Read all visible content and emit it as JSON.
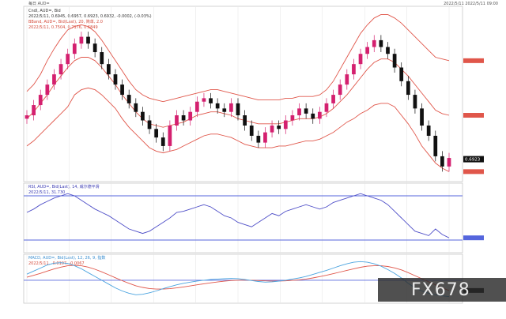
{
  "header": {
    "left": "每日  AUD=",
    "right": "2022/5/11  2022/5/11 09:00"
  },
  "panels": {
    "price": {
      "legend": [
        {
          "text": "Cndl, AUD=, Bid",
          "color": "#333333"
        },
        {
          "text": "2022/5/11, 0.6945, 0.6957, 0.6923, 0.6932, -0.0002, (-0.03%)",
          "color": "#333333"
        },
        {
          "text": "BBand, AUD=, Bid(Last), 20, 简单, 2.0",
          "color": "#d44a3a"
        },
        {
          "text": "2022/5/11, 0.7504, 0.7176, 0.6849",
          "color": "#d44a3a"
        }
      ]
    },
    "rsi": {
      "legend": [
        {
          "text": "RSI, AUD=, Bid(Last), 14, 威尔德平滑",
          "color": "#3b3bb3"
        },
        {
          "text": "2022/5/11, 31.730",
          "color": "#3b3bb3"
        }
      ]
    },
    "macd": {
      "legend": [
        {
          "text": "MACD, AUD=, Bid(Last), 12, 26, 9, 指数",
          "color": "#3b8fd0"
        },
        {
          "text": "2022/5/11, -0.0107, -0.0067",
          "color": "#d44a3a"
        }
      ]
    }
  },
  "watermark": "FX678",
  "colors": {
    "up": "#d4206f",
    "down": "#111111",
    "bands": "#e0564a",
    "rsi": "#4f4fc8",
    "macd": "#4aa3df",
    "signal": "#e0564a",
    "ref": "#5566dd",
    "grid": "#e3e3e3"
  },
  "chart_data": [
    {
      "type": "candlestick",
      "series": [
        {
          "name": "Cndl, AUD=, Bid",
          "close": [
            0.718,
            0.724,
            0.73,
            0.736,
            0.742,
            0.748,
            0.754,
            0.76,
            0.764,
            0.76,
            0.755,
            0.748,
            0.742,
            0.736,
            0.73,
            0.725,
            0.72,
            0.715,
            0.71,
            0.705,
            0.7,
            0.712,
            0.718,
            0.715,
            0.72,
            0.726,
            0.728,
            0.725,
            0.722,
            0.72,
            0.725,
            0.718,
            0.712,
            0.706,
            0.702,
            0.708,
            0.712,
            0.71,
            0.715,
            0.718,
            0.722,
            0.719,
            0.716,
            0.72,
            0.725,
            0.73,
            0.736,
            0.742,
            0.748,
            0.754,
            0.758,
            0.762,
            0.758,
            0.754,
            0.746,
            0.738,
            0.73,
            0.722,
            0.712,
            0.706,
            0.694,
            0.688,
            0.693
          ]
        },
        {
          "name": "BBand upper",
          "values": [
            0.732,
            0.736,
            0.742,
            0.75,
            0.757,
            0.763,
            0.768,
            0.77,
            0.771,
            0.77,
            0.767,
            0.762,
            0.756,
            0.75,
            0.744,
            0.738,
            0.733,
            0.73,
            0.728,
            0.727,
            0.726,
            0.727,
            0.728,
            0.729,
            0.73,
            0.731,
            0.732,
            0.733,
            0.733,
            0.732,
            0.731,
            0.73,
            0.729,
            0.728,
            0.727,
            0.727,
            0.727,
            0.727,
            0.728,
            0.728,
            0.729,
            0.729,
            0.729,
            0.73,
            0.733,
            0.738,
            0.745,
            0.752,
            0.759,
            0.766,
            0.771,
            0.775,
            0.777,
            0.777,
            0.775,
            0.772,
            0.768,
            0.764,
            0.76,
            0.756,
            0.752,
            0.751,
            0.75
          ]
        },
        {
          "name": "BBand middle",
          "values": [
            0.716,
            0.72,
            0.725,
            0.73,
            0.736,
            0.741,
            0.746,
            0.75,
            0.752,
            0.752,
            0.75,
            0.746,
            0.741,
            0.736,
            0.73,
            0.725,
            0.72,
            0.716,
            0.713,
            0.712,
            0.711,
            0.712,
            0.713,
            0.714,
            0.716,
            0.718,
            0.719,
            0.72,
            0.72,
            0.719,
            0.718,
            0.716,
            0.715,
            0.714,
            0.713,
            0.713,
            0.713,
            0.713,
            0.714,
            0.715,
            0.716,
            0.716,
            0.716,
            0.717,
            0.719,
            0.722,
            0.726,
            0.73,
            0.735,
            0.74,
            0.745,
            0.749,
            0.751,
            0.751,
            0.749,
            0.745,
            0.741,
            0.736,
            0.731,
            0.726,
            0.721,
            0.719,
            0.718
          ]
        },
        {
          "name": "BBand lower",
          "values": [
            0.7,
            0.703,
            0.707,
            0.711,
            0.715,
            0.719,
            0.723,
            0.73,
            0.733,
            0.734,
            0.733,
            0.73,
            0.726,
            0.722,
            0.716,
            0.711,
            0.707,
            0.703,
            0.699,
            0.697,
            0.696,
            0.697,
            0.698,
            0.7,
            0.702,
            0.704,
            0.706,
            0.707,
            0.707,
            0.706,
            0.705,
            0.703,
            0.701,
            0.7,
            0.699,
            0.699,
            0.699,
            0.7,
            0.7,
            0.701,
            0.702,
            0.703,
            0.703,
            0.704,
            0.706,
            0.708,
            0.711,
            0.714,
            0.716,
            0.719,
            0.721,
            0.724,
            0.725,
            0.725,
            0.723,
            0.718,
            0.713,
            0.707,
            0.7,
            0.695,
            0.69,
            0.687,
            0.685
          ]
        }
      ],
      "last_value": 0.6923
    },
    {
      "type": "line",
      "series": [
        {
          "name": "RSI, AUD=, Bid(Last), 14",
          "values": [
            55,
            58,
            62,
            65,
            68,
            70,
            72,
            70,
            66,
            62,
            58,
            55,
            52,
            48,
            44,
            40,
            38,
            36,
            38,
            42,
            46,
            50,
            55,
            56,
            58,
            60,
            62,
            60,
            56,
            52,
            50,
            46,
            44,
            42,
            46,
            50,
            54,
            52,
            56,
            58,
            60,
            62,
            60,
            58,
            60,
            64,
            66,
            68,
            70,
            72,
            70,
            68,
            66,
            62,
            56,
            50,
            44,
            38,
            36,
            34,
            40,
            35,
            32
          ]
        }
      ],
      "ylim": [
        20,
        80
      ]
    },
    {
      "type": "line",
      "series": [
        {
          "name": "MACD",
          "values": [
            0.004,
            0.006,
            0.008,
            0.01,
            0.0112,
            0.0115,
            0.011,
            0.0095,
            0.0075,
            0.005,
            0.0025,
            0.0,
            -0.0025,
            -0.005,
            -0.007,
            -0.0085,
            -0.0095,
            -0.0092,
            -0.0082,
            -0.007,
            -0.0055,
            -0.0042,
            -0.003,
            -0.002,
            -0.0012,
            -0.0005,
            0.0,
            0.0005,
            0.0008,
            0.001,
            0.0012,
            0.001,
            0.0005,
            -0.0002,
            -0.0008,
            -0.0012,
            -0.001,
            -0.0006,
            0.0,
            0.0008,
            0.0015,
            0.0025,
            0.0038,
            0.0052,
            0.0065,
            0.008,
            0.0095,
            0.0108,
            0.0118,
            0.0122,
            0.0118,
            0.0108,
            0.0092,
            0.007,
            0.0045,
            0.0015,
            -0.002,
            -0.005,
            -0.007,
            -0.0085,
            -0.0095,
            -0.0102,
            -0.0107
          ]
        },
        {
          "name": "Signal",
          "values": [
            0.002,
            0.0032,
            0.0045,
            0.006,
            0.0074,
            0.0086,
            0.0095,
            0.0098,
            0.0095,
            0.0086,
            0.0072,
            0.0055,
            0.0036,
            0.0016,
            -0.0003,
            -0.002,
            -0.0036,
            -0.0047,
            -0.0054,
            -0.0058,
            -0.0058,
            -0.0055,
            -0.005,
            -0.0044,
            -0.0037,
            -0.003,
            -0.0023,
            -0.0017,
            -0.0011,
            -0.0006,
            -0.0002,
            0.0,
            0.0001,
            0.0,
            -0.0002,
            -0.0004,
            -0.0005,
            -0.0005,
            -0.0004,
            -0.0001,
            0.0002,
            0.0008,
            0.0015,
            0.0024,
            0.0033,
            0.0043,
            0.0054,
            0.0065,
            0.0075,
            0.0085,
            0.0092,
            0.0095,
            0.0095,
            0.009,
            0.0081,
            0.0068,
            0.005,
            0.003,
            0.001,
            -0.001,
            -0.003,
            -0.005,
            -0.0067
          ]
        }
      ],
      "ylim": [
        -0.014,
        0.016
      ]
    }
  ]
}
